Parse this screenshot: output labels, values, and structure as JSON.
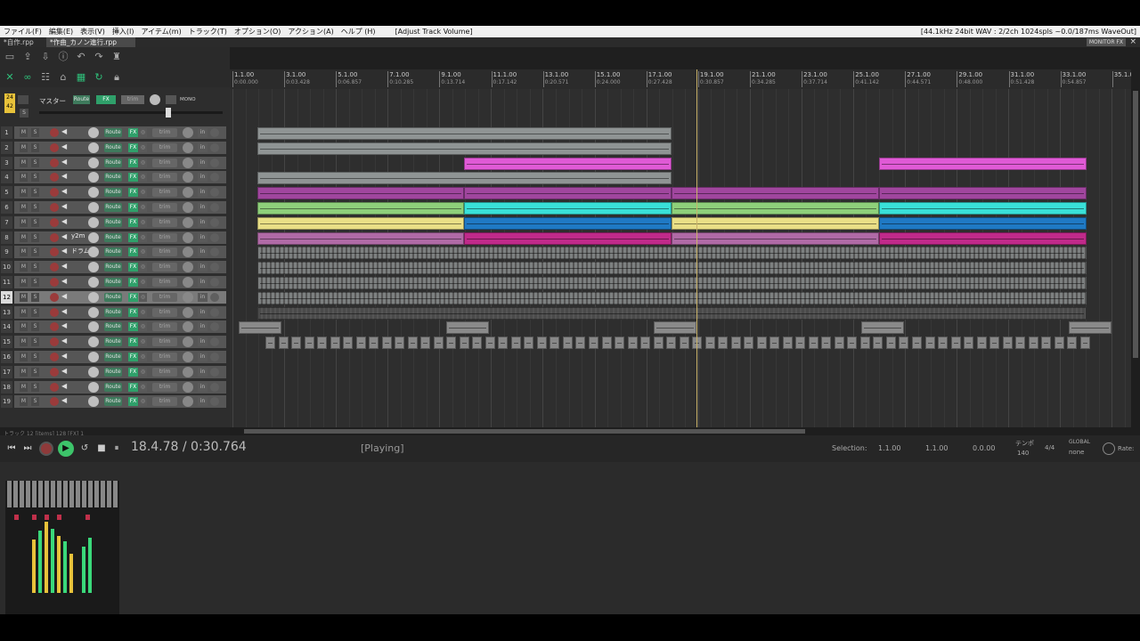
{
  "menu": {
    "items": [
      "ファイル(F)",
      "編集(E)",
      "表示(V)",
      "挿入(I)",
      "アイテム(m)",
      "トラック(T)",
      "オプション(O)",
      "アクション(A)",
      "ヘルプ (H)"
    ],
    "action": "[Adjust Track Volume]",
    "status": "[44.1kHz 24bit WAV : 2/2ch 1024spls ~0.0/187ms WaveOut]"
  },
  "tabs": [
    {
      "label": "*自作.rpp"
    },
    {
      "label": "*作曲_カノン進行.rpp"
    }
  ],
  "monitor_fx": "MONITOR FX",
  "tab_close": "×",
  "master": {
    "label": "マスター",
    "route": "Route",
    "fx": "FX",
    "trim": "trim",
    "mono": "MONO",
    "sig_top": "24",
    "sig_bottom": "42"
  },
  "track_common": {
    "m": "M",
    "s": "S",
    "route": "Route",
    "fx": "FX",
    "trim": "trim",
    "in": "in"
  },
  "tracks": [
    {
      "num": "1",
      "name": ""
    },
    {
      "num": "2",
      "name": ""
    },
    {
      "num": "3",
      "name": ""
    },
    {
      "num": "4",
      "name": ""
    },
    {
      "num": "5",
      "name": ""
    },
    {
      "num": "6",
      "name": ""
    },
    {
      "num": "7",
      "name": ""
    },
    {
      "num": "8",
      "name": "y2m"
    },
    {
      "num": "9",
      "name": "ドラム"
    },
    {
      "num": "10",
      "name": ""
    },
    {
      "num": "11",
      "name": ""
    },
    {
      "num": "12",
      "name": ""
    },
    {
      "num": "13",
      "name": ""
    },
    {
      "num": "14",
      "name": ""
    },
    {
      "num": "15",
      "name": ""
    },
    {
      "num": "16",
      "name": ""
    },
    {
      "num": "17",
      "name": ""
    },
    {
      "num": "18",
      "name": ""
    },
    {
      "num": "19",
      "name": ""
    }
  ],
  "selected_track": "12",
  "ruler": {
    "bars": [
      "1.1.00",
      "3.1.00",
      "5.1.00",
      "7.1.00",
      "9.1.00",
      "11.1.00",
      "13.1.00",
      "15.1.00",
      "17.1.00",
      "19.1.00",
      "21.1.00",
      "23.1.00",
      "25.1.00",
      "27.1.00",
      "29.1.00",
      "31.1.00",
      "33.1.00",
      "35.1.00"
    ],
    "times": [
      "0:00.000",
      "0:03.428",
      "0:06.857",
      "0:10.285",
      "0:13.714",
      "0:17.142",
      "0:20.571",
      "0:24.000",
      "0:27.428",
      "0:30.857",
      "0:34.285",
      "0:37.714",
      "0:41.142",
      "0:44.571",
      "0:48.000",
      "0:51.428",
      "0:54.857",
      ""
    ]
  },
  "colors": {
    "gray_item": "#8f9494",
    "pink": "#e05ad6",
    "purple": "#a0469e",
    "green": "#8ed07a",
    "cyan": "#39e0d8",
    "yellow": "#e9df86",
    "blue": "#1f79c4",
    "magenta": "#c02a8a",
    "mauve": "#b06aa6",
    "drum": "#7d8080",
    "cursor": "#c9b26a"
  },
  "status_line": "トラック 12 [items] 128 [FX] 1",
  "transport": {
    "position": "18.4.78 / 0:30.764",
    "state": "[Playing]",
    "selection_label": "Selection:",
    "sel_start": "1.1.00",
    "sel_end": "1.1.00",
    "sel_len": "0.0.00",
    "tempo_label": "テンポ",
    "tempo": "140",
    "time_sig": "4/4",
    "global": "GLOBAL",
    "none": "none",
    "rate": "Rate:"
  }
}
